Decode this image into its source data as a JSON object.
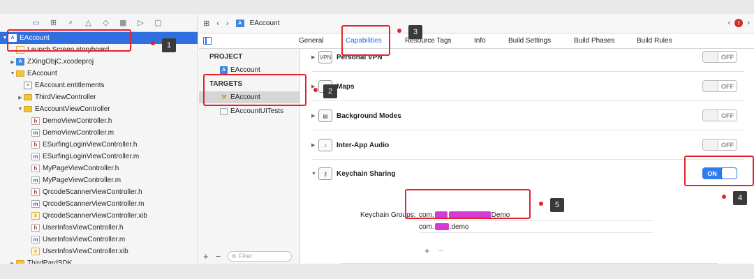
{
  "jumpbar": {
    "file": "EAccount"
  },
  "tabs": [
    "General",
    "Capabilities",
    "Resource Tags",
    "Info",
    "Build Settings",
    "Build Phases",
    "Build Rules"
  ],
  "tree": [
    {
      "label": "EAccount",
      "icon": "project",
      "depth": 0,
      "disc": "▼",
      "selected": true
    },
    {
      "label": "Launch Screen.storyboard",
      "icon": "sb",
      "depth": 1,
      "disc": ""
    },
    {
      "label": "ZXingObjC.xcodeproj",
      "icon": "project",
      "depth": 1,
      "disc": "▶"
    },
    {
      "label": "EAccount",
      "icon": "folder",
      "depth": 1,
      "disc": "▼"
    },
    {
      "label": "EAccount.entitlements",
      "icon": "ent",
      "depth": 2,
      "disc": ""
    },
    {
      "label": "ThirdViewController",
      "icon": "folder",
      "depth": 2,
      "disc": "▶"
    },
    {
      "label": "EAccountViewController",
      "icon": "folder",
      "depth": 2,
      "disc": "▼"
    },
    {
      "label": "DemoViewController.h",
      "icon": "h",
      "depth": 3,
      "disc": ""
    },
    {
      "label": "DemoViewController.m",
      "icon": "m",
      "depth": 3,
      "disc": ""
    },
    {
      "label": "ESurfingLoginViewController.h",
      "icon": "h",
      "depth": 3,
      "disc": ""
    },
    {
      "label": "ESurfingLoginViewController.m",
      "icon": "m",
      "depth": 3,
      "disc": ""
    },
    {
      "label": "MyPageViewController.h",
      "icon": "h",
      "depth": 3,
      "disc": ""
    },
    {
      "label": "MyPageViewController.m",
      "icon": "m",
      "depth": 3,
      "disc": ""
    },
    {
      "label": "QrcodeScannerViewController.h",
      "icon": "h",
      "depth": 3,
      "disc": ""
    },
    {
      "label": "QrcodeScannerViewController.m",
      "icon": "m",
      "depth": 3,
      "disc": ""
    },
    {
      "label": "QrcodeScannerViewController.xib",
      "icon": "xib",
      "depth": 3,
      "disc": ""
    },
    {
      "label": "UserInfosViewController.h",
      "icon": "h",
      "depth": 3,
      "disc": ""
    },
    {
      "label": "UserInfosViewController.m",
      "icon": "m",
      "depth": 3,
      "disc": ""
    },
    {
      "label": "UserInfosViewController.xib",
      "icon": "xib",
      "depth": 3,
      "disc": ""
    },
    {
      "label": "ThirdPardSDK",
      "icon": "folder",
      "depth": 1,
      "disc": "▶"
    }
  ],
  "targets_panel": {
    "project_header": "PROJECT",
    "project_item": "EAccount",
    "targets_header": "TARGETS",
    "target_items": [
      "EAccount",
      "EAccountUITests"
    ],
    "filter_placeholder": "Filter"
  },
  "capabilities": [
    {
      "name": "Personal VPN",
      "icon_text": "VPN",
      "state": "OFF"
    },
    {
      "name": "Maps",
      "icon_text": "◎",
      "state": "OFF"
    },
    {
      "name": "Background Modes",
      "icon_text": "▤",
      "state": "OFF"
    },
    {
      "name": "Inter-App Audio",
      "icon_text": "♪",
      "state": "OFF"
    },
    {
      "name": "Keychain Sharing",
      "icon_text": "⚷",
      "state": "ON"
    }
  ],
  "keychain": {
    "groups_label": "Keychain Groups:",
    "group1_prefix": "com.",
    "group1_suffix": "Demo",
    "group2_prefix": "com.",
    "group2_suffix": ".demo",
    "add": "+",
    "remove": "−"
  },
  "annotations": [
    "1",
    "2",
    "3",
    "4",
    "5"
  ],
  "colors": {
    "accent": "#2f6fe0",
    "highlight": "#e8202a",
    "redaction": "#d43bd4"
  }
}
